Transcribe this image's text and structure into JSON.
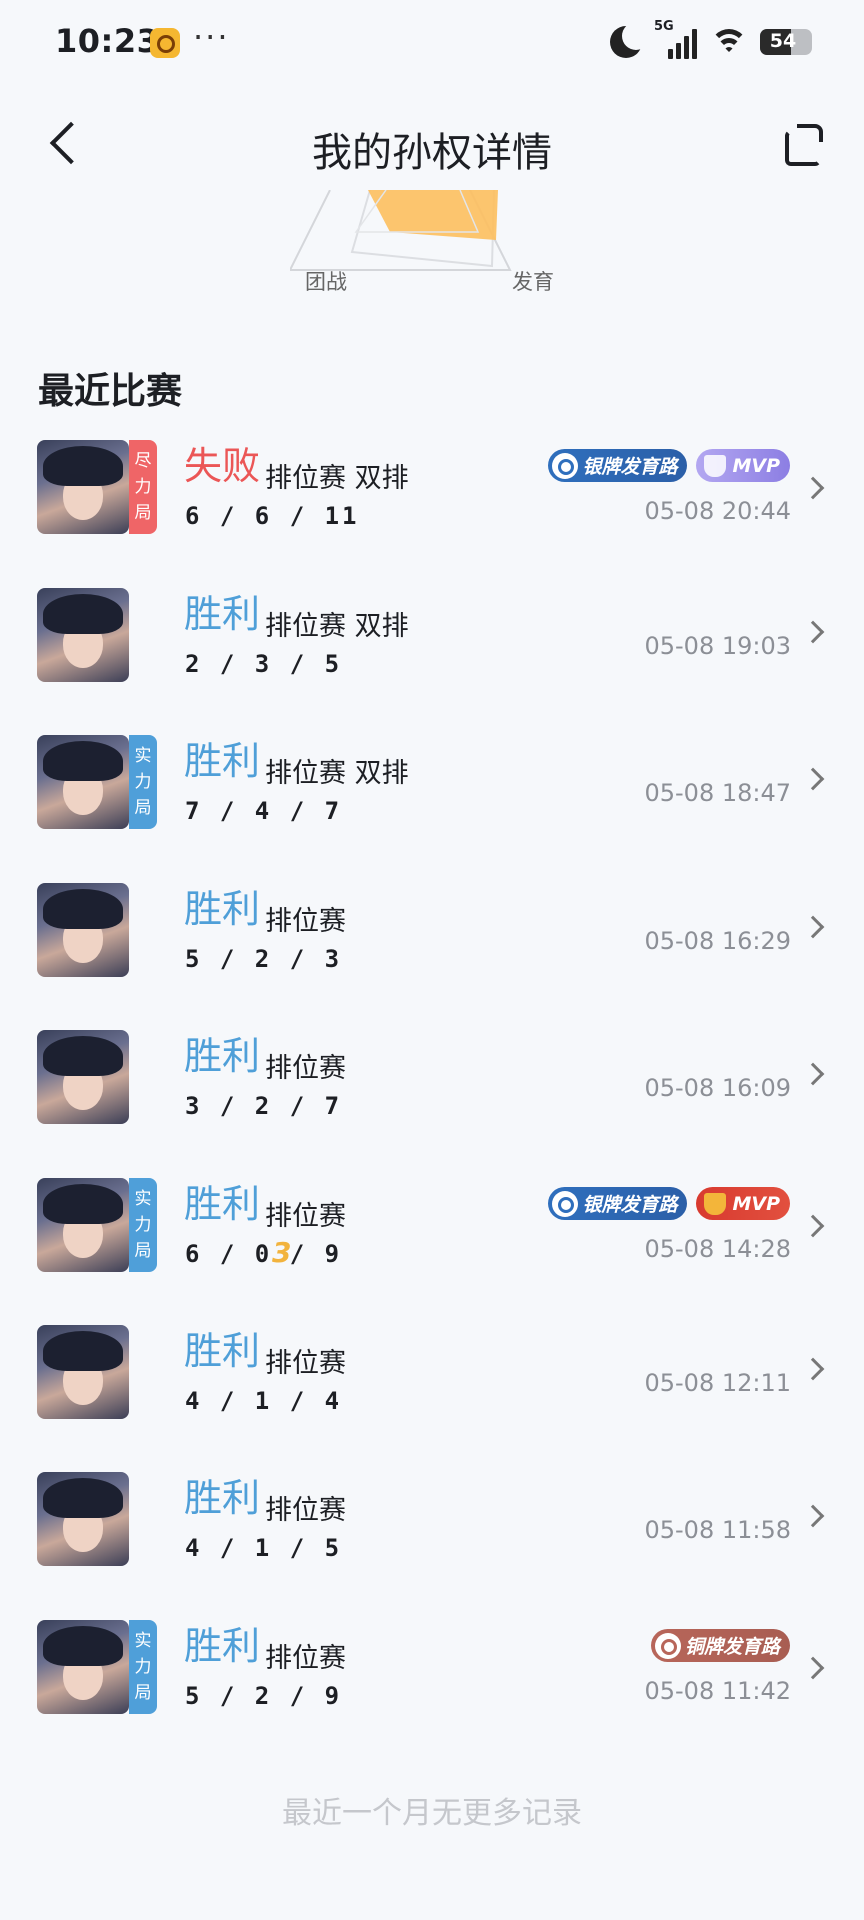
{
  "status_bar": {
    "time": "10:23",
    "network": "5G",
    "battery": "54",
    "icons": [
      "app-notification-icon",
      "more-dots-icon",
      "moon-icon",
      "signal-icon",
      "wifi-icon",
      "battery-icon"
    ]
  },
  "header": {
    "title": "我的孙权详情",
    "back_icon": "back-chevron-icon",
    "share_icon": "share-icon"
  },
  "radar": {
    "labels": [
      "团战",
      "发育"
    ],
    "fill_color": "#fdbf5e"
  },
  "section": {
    "title": "最近比赛"
  },
  "matches": [
    {
      "result": "失败",
      "outcome": "lose",
      "mode": "排位赛 双排",
      "kda": "6 / 6 / 11",
      "time": "05-08 20:44",
      "badge": "尽力局",
      "badge_color": "red",
      "tags": [
        {
          "text": "银牌发育路",
          "style": "silver"
        },
        {
          "text": "MVP",
          "style": "mvp-purple"
        }
      ],
      "multikill": ""
    },
    {
      "result": "胜利",
      "outcome": "win",
      "mode": "排位赛 双排",
      "kda": "2 / 3 / 5",
      "time": "05-08 19:03",
      "badge": "",
      "badge_color": "",
      "tags": [],
      "multikill": ""
    },
    {
      "result": "胜利",
      "outcome": "win",
      "mode": "排位赛 双排",
      "kda": "7 / 4 / 7",
      "time": "05-08 18:47",
      "badge": "实力局",
      "badge_color": "blue",
      "tags": [],
      "multikill": ""
    },
    {
      "result": "胜利",
      "outcome": "win",
      "mode": "排位赛",
      "kda": "5 / 2 / 3",
      "time": "05-08 16:29",
      "badge": "",
      "badge_color": "",
      "tags": [],
      "multikill": ""
    },
    {
      "result": "胜利",
      "outcome": "win",
      "mode": "排位赛",
      "kda": "3 / 2 / 7",
      "time": "05-08 16:09",
      "badge": "",
      "badge_color": "",
      "tags": [],
      "multikill": ""
    },
    {
      "result": "胜利",
      "outcome": "win",
      "mode": "排位赛",
      "kda": "6 / 0 / 9",
      "time": "05-08 14:28",
      "badge": "实力局",
      "badge_color": "blue",
      "tags": [
        {
          "text": "银牌发育路",
          "style": "silver"
        },
        {
          "text": "MVP",
          "style": "mvp-red"
        }
      ],
      "multikill": "3"
    },
    {
      "result": "胜利",
      "outcome": "win",
      "mode": "排位赛",
      "kda": "4 / 1 / 4",
      "time": "05-08 12:11",
      "badge": "",
      "badge_color": "",
      "tags": [],
      "multikill": ""
    },
    {
      "result": "胜利",
      "outcome": "win",
      "mode": "排位赛",
      "kda": "4 / 1 / 5",
      "time": "05-08 11:58",
      "badge": "",
      "badge_color": "",
      "tags": [],
      "multikill": ""
    },
    {
      "result": "胜利",
      "outcome": "win",
      "mode": "排位赛",
      "kda": "5 / 2 / 9",
      "time": "05-08 11:42",
      "badge": "实力局",
      "badge_color": "blue",
      "tags": [
        {
          "text": "铜牌发育路",
          "style": "bronze"
        }
      ],
      "multikill": ""
    }
  ],
  "footer": {
    "note": "最近一个月无更多记录"
  }
}
